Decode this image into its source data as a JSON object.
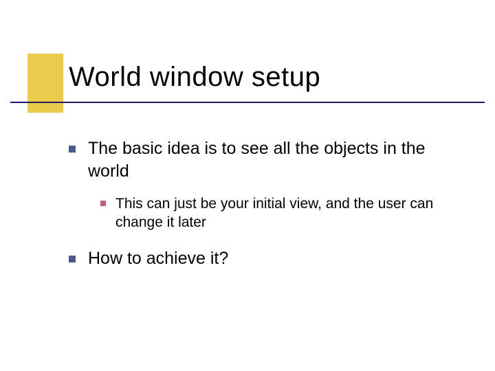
{
  "slide": {
    "title": "World window setup",
    "bullets": [
      {
        "text": "The basic idea is to see all the objects in the world",
        "children": [
          {
            "text": "This can just be your initial view, and the user can change it later"
          }
        ]
      },
      {
        "text": "How to achieve it?"
      }
    ]
  }
}
